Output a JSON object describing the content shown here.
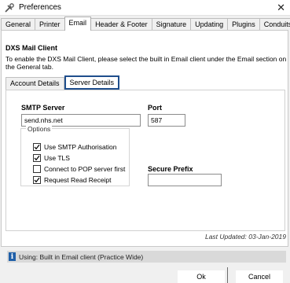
{
  "window": {
    "title": "Preferences"
  },
  "main_tabs": [
    {
      "label": "General"
    },
    {
      "label": "Printer"
    },
    {
      "label": "Email",
      "active": true
    },
    {
      "label": "Header & Footer"
    },
    {
      "label": "Signature"
    },
    {
      "label": "Updating"
    },
    {
      "label": "Plugins"
    },
    {
      "label": "Conduits"
    }
  ],
  "email": {
    "section_title": "DXS Mail Client",
    "description": "To enable the DXS Mail Client, please select the built in Email client under the Email section on the General tab.",
    "sub_tabs": [
      {
        "label": "Account Details"
      },
      {
        "label": "Server Details",
        "active": true
      }
    ],
    "server": {
      "smtp_label": "SMTP Server",
      "smtp_value": "send.nhs.net",
      "port_label": "Port",
      "port_value": "587",
      "options_label": "Options",
      "options": [
        {
          "label": "Use SMTP Authorisation",
          "checked": true
        },
        {
          "label": "Use TLS",
          "checked": true
        },
        {
          "label": "Connect to POP server first",
          "checked": false
        },
        {
          "label": "Request Read Receipt",
          "checked": true
        }
      ],
      "secure_prefix_label": "Secure Prefix",
      "secure_prefix_value": ""
    },
    "last_updated": "Last Updated: 03-Jan-2019"
  },
  "status": {
    "text": "Using: Built in Email client (Practice Wide)"
  },
  "buttons": {
    "ok": "Ok",
    "cancel": "Cancel"
  },
  "colors": {
    "highlight": "#1f4e8c",
    "info_icon": "#1f5fa8"
  }
}
